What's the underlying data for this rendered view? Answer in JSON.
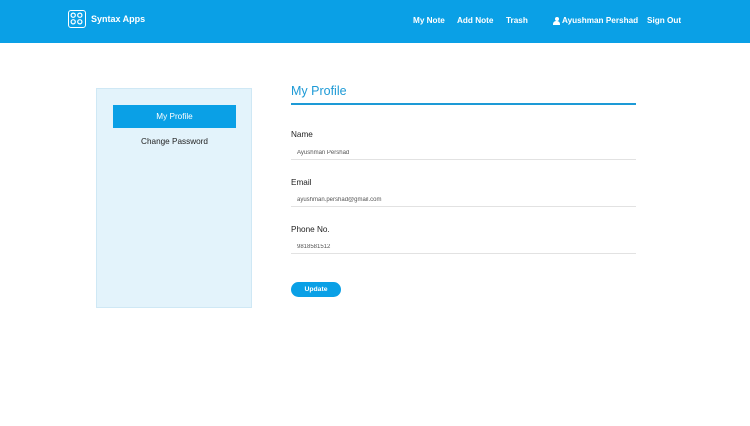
{
  "brand": {
    "name": "Syntax Apps",
    "logo_icon": "grid-logo-icon"
  },
  "nav": {
    "my_note": "My Note",
    "add_note": "Add Note",
    "trash": "Trash",
    "user_name": "Ayushman Pershad",
    "user_icon": "user-icon",
    "sign_out": "Sign Out"
  },
  "sidebar": {
    "items": [
      {
        "label": "My Profile",
        "active": true
      },
      {
        "label": "Change Password",
        "active": false
      }
    ]
  },
  "profile": {
    "title": "My Profile",
    "fields": [
      {
        "label": "Name",
        "value": "Ayushman Pershad"
      },
      {
        "label": "Email",
        "value": "ayushman.pershad@gmail.com"
      },
      {
        "label": "Phone No.",
        "value": "9818581512"
      }
    ],
    "update_label": "Update"
  },
  "colors": {
    "primary": "#0aa0e6",
    "title_blue": "#1d9ad6",
    "sidebar_bg": "#e3f3fb"
  }
}
